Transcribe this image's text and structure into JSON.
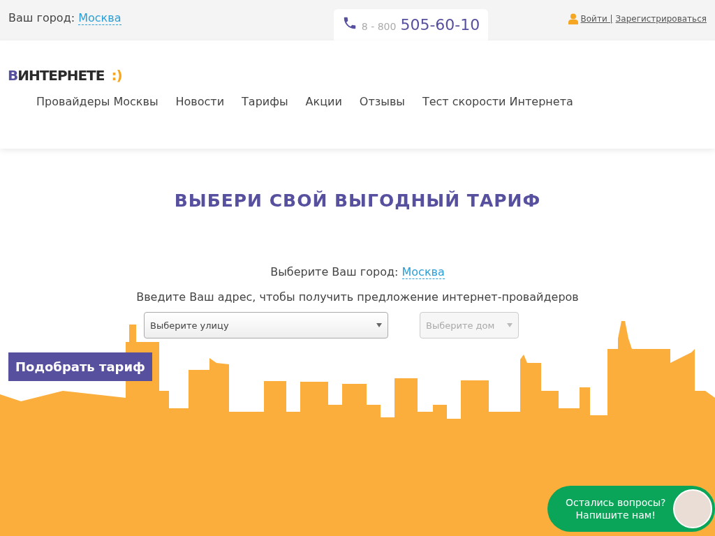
{
  "top_bar": {
    "city_label": "Ваш город:",
    "city": "Москва",
    "phone": {
      "prefix": "8 - 800",
      "number": "505-60-10"
    },
    "auth": [
      {
        "label": "Войти |"
      },
      {
        "label": "Зарегистрироваться"
      }
    ]
  },
  "logo": {
    "letter": "В",
    "word": "ИНТЕРНЕТЕ",
    "smile": ":)"
  },
  "nav": [
    "Провайдеры Москвы",
    "Новости",
    "Тарифы",
    "Акции",
    "Отзывы",
    "Тест скорости Интернета"
  ],
  "main": {
    "title": "ВЫБЕРИ СВОЙ ВЫГОДНЫЙ ТАРИФ",
    "city_label": "Выберите Ваш город:",
    "city": "Москва",
    "hint": "Введите Ваш адрес, чтобы получить предложение интернет-провайдеров",
    "selects": [
      {
        "placeholder": "Выберите улицу",
        "disabled": false
      },
      {
        "placeholder": "Выберите дом",
        "disabled": true
      }
    ],
    "button": "Подобрать тариф"
  },
  "chat": {
    "lines": [
      "Остались вопросы?",
      "Напишите нам!"
    ]
  }
}
